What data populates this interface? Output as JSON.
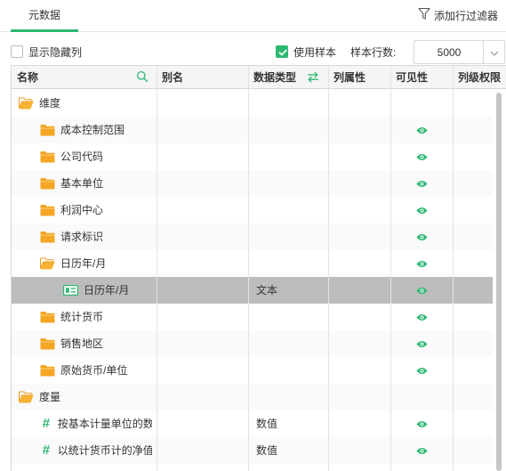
{
  "colors": {
    "accent": "#2eb872",
    "selected_row": "#bcbcbc",
    "folder": "#f5a623"
  },
  "tabs": [
    {
      "label": "元数据",
      "active": true
    }
  ],
  "toolbar": {
    "add_filter_label": "添加行过滤器",
    "filter_icon": "funnel-icon"
  },
  "options": {
    "show_hidden_label": "显示隐藏列",
    "show_hidden_checked": false,
    "use_sample_label": "使用样本",
    "use_sample_checked": true,
    "sample_rows_label": "样本行数:",
    "sample_rows_value": "5000"
  },
  "columns": [
    {
      "label": "名称",
      "icon": "search-icon"
    },
    {
      "label": "别名"
    },
    {
      "label": "数据类型",
      "icon": "swap-icon"
    },
    {
      "label": "列属性"
    },
    {
      "label": "可见性"
    },
    {
      "label": "列级权限"
    }
  ],
  "rows": [
    {
      "name": "维度",
      "level": 0,
      "icon": "folder-open-icon",
      "type": "",
      "visible": false
    },
    {
      "name": "成本控制范围",
      "level": 1,
      "icon": "folder-icon",
      "type": "",
      "visible": true
    },
    {
      "name": "公司代码",
      "level": 1,
      "icon": "folder-icon",
      "type": "",
      "visible": true
    },
    {
      "name": "基本单位",
      "level": 1,
      "icon": "folder-icon",
      "type": "",
      "visible": true
    },
    {
      "name": "利润中心",
      "level": 1,
      "icon": "folder-icon",
      "type": "",
      "visible": true
    },
    {
      "name": "请求标识",
      "level": 1,
      "icon": "folder-icon",
      "type": "",
      "visible": true
    },
    {
      "name": "日历年/月",
      "level": 1,
      "icon": "folder-open-icon",
      "type": "",
      "visible": true
    },
    {
      "name": "日历年/月",
      "level": 2,
      "icon": "field-icon",
      "type": "文本",
      "visible": true,
      "selected": true
    },
    {
      "name": "统计货币",
      "level": 1,
      "icon": "folder-icon",
      "type": "",
      "visible": true
    },
    {
      "name": "销售地区",
      "level": 1,
      "icon": "folder-icon",
      "type": "",
      "visible": true
    },
    {
      "name": "原始货币/单位",
      "level": 1,
      "icon": "folder-icon",
      "type": "",
      "visible": true
    },
    {
      "name": "度量",
      "level": 0,
      "icon": "folder-open-icon",
      "type": "",
      "visible": false
    },
    {
      "name": "按基本计量单位的数",
      "level": 1,
      "icon": "hash-icon",
      "type": "数值",
      "visible": true
    },
    {
      "name": "以统计货币计的净值",
      "level": 1,
      "icon": "hash-icon",
      "type": "数值",
      "visible": true
    }
  ]
}
